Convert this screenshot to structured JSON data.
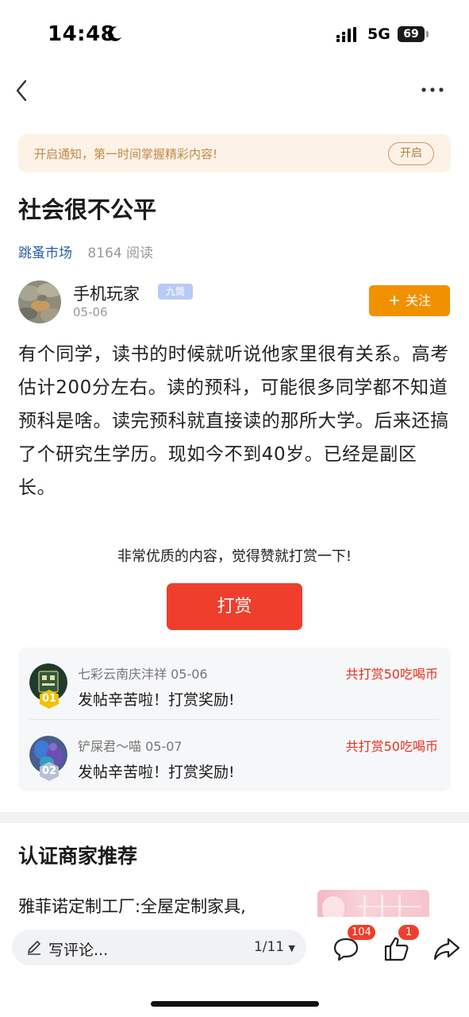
{
  "status_bar": {
    "time": "14:48",
    "network": "5G",
    "battery": "69"
  },
  "nav": {
    "back_icon": "chevron-left-icon",
    "more_icon": "more-dots-icon"
  },
  "notice": {
    "text": "开启通知，第一时间掌握精彩内容!",
    "button": "开启"
  },
  "post": {
    "title": "社会很不公平",
    "channel": "跳蚤市场",
    "reads": "8164 阅读",
    "author": {
      "name": "手机玩家",
      "badge": "九筒",
      "date": "05-06"
    },
    "follow_label": "关注",
    "body": "有个同学，读书的时候就听说他家里很有关系。高考估计200分左右。读的预科，可能很多同学都不知道预科是啥。读完预科就直接读的那所大学。后来还搞了个研究生学历。现如今不到40岁。已经是副区长。"
  },
  "reward": {
    "prompt": "非常优质的内容，觉得赞就打赏一下!",
    "button": "打赏",
    "items": [
      {
        "rank": "01",
        "name": "七彩云南庆沣祥 05-06",
        "message": "发帖辛苦啦！打赏奖励!",
        "amount": "共打赏50吃喝币",
        "rank_color": "#f2c200"
      },
      {
        "rank": "02",
        "name": "铲屎君～喵 05-07",
        "message": "发帖辛苦啦！打赏奖励!",
        "amount": "共打赏50吃喝币",
        "rank_color": "#b9c2cf"
      }
    ]
  },
  "recommend": {
    "title": "认证商家推荐",
    "item_text": "雅菲诺定制工厂:全屋定制家具,"
  },
  "bottom_bar": {
    "comment_placeholder": "写评论...",
    "page_indicator": "1/11",
    "comment_count": "104",
    "like_count": "1"
  },
  "colors": {
    "accent_orange": "#f29100",
    "reward_red": "#ef3e2c",
    "link_blue": "#2a5ea8"
  }
}
